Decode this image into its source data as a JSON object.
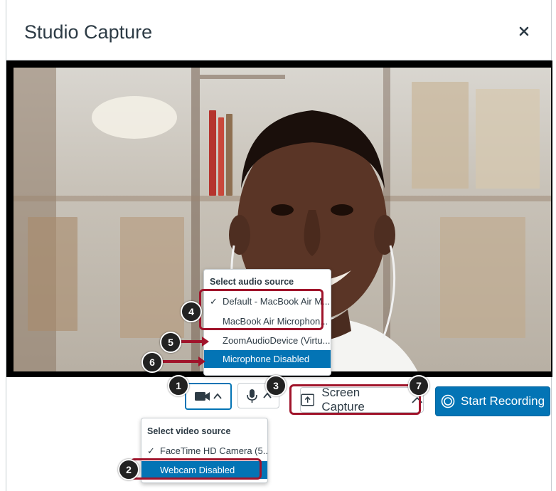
{
  "dialog": {
    "title": "Studio Capture",
    "close_icon": "close-icon"
  },
  "audio_menu": {
    "header": "Select audio source",
    "items": [
      {
        "label": "Default - MacBook Air M...",
        "checked": true,
        "selected": false
      },
      {
        "label": "MacBook Air Microphon...",
        "checked": false,
        "selected": false
      },
      {
        "label": "ZoomAudioDevice (Virtu...",
        "checked": false,
        "selected": false
      },
      {
        "label": "Microphone Disabled",
        "checked": false,
        "selected": true
      }
    ]
  },
  "video_menu": {
    "header": "Select video source",
    "items": [
      {
        "label": "FaceTime HD Camera (5...",
        "checked": true,
        "selected": false
      },
      {
        "label": "Webcam Disabled",
        "checked": false,
        "selected": true
      }
    ]
  },
  "controls": {
    "camera_icon": "video-camera-icon",
    "mic_icon": "microphone-icon",
    "screen_capture_label": "Screen Capture",
    "start_recording_label": "Start Recording"
  },
  "callouts": [
    "1",
    "2",
    "3",
    "4",
    "5",
    "6",
    "7"
  ],
  "colors": {
    "accent": "#0374b5",
    "highlight": "#a0142b",
    "callout_bg": "#222222"
  }
}
